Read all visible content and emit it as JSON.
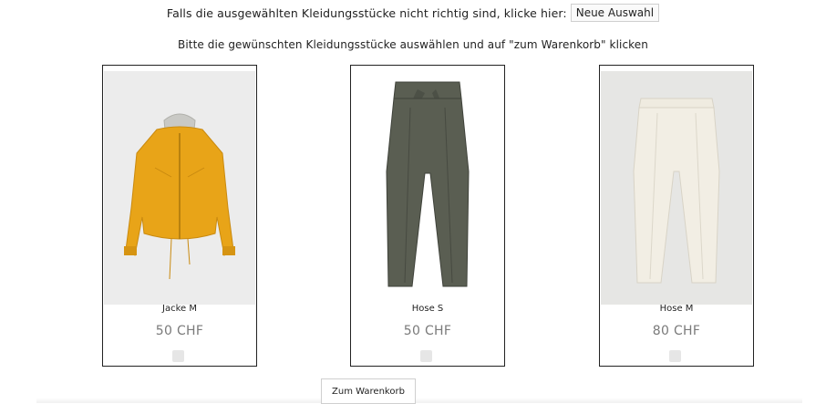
{
  "header": {
    "reset_text": "Falls die ausgewählten Kleidungsstücke nicht richtig sind, klicke hier:",
    "reset_button": "Neue Auswahl",
    "instruction": "Bitte die gewünschten Kleidungsstücke auswählen und auf \"zum Warenkorb\" klicken"
  },
  "products": [
    {
      "name": "Jacke M",
      "price": "50 CHF",
      "icon": "yellow-jacket-image",
      "color": "#e8a418"
    },
    {
      "name": "Hose S",
      "price": "50 CHF",
      "icon": "olive-trousers-image",
      "color": "#5a5e52"
    },
    {
      "name": "Hose M",
      "price": "80 CHF",
      "icon": "cream-trousers-image",
      "color": "#efebe0"
    }
  ],
  "cart_button": "Zum Warenkorb"
}
